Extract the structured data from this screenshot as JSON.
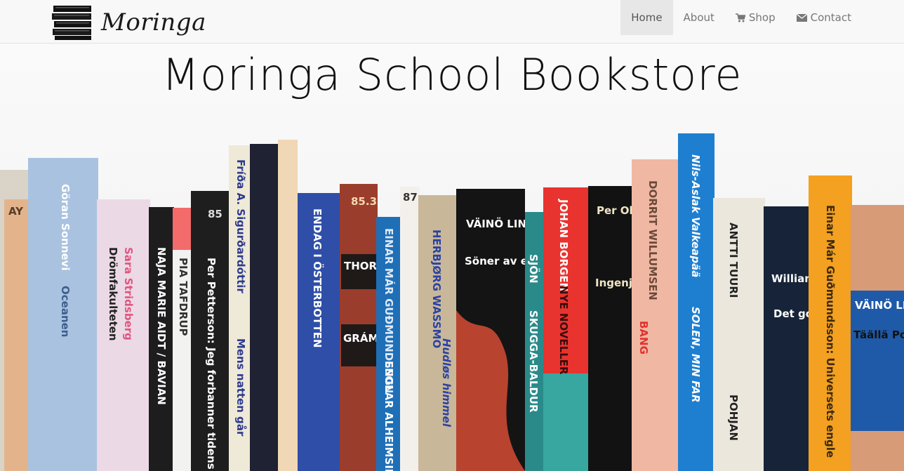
{
  "brand": {
    "name": "Moringa",
    "logo_icon": "stacked-books-icon"
  },
  "nav": {
    "items": [
      {
        "label": "Home",
        "icon": "",
        "active": true
      },
      {
        "label": "About",
        "icon": "",
        "active": false
      },
      {
        "label": "Shop",
        "icon": "cart-icon",
        "active": false
      },
      {
        "label": "Contact",
        "icon": "envelope-icon",
        "active": false
      }
    ]
  },
  "hero": {
    "title": "Moringa School Bookstore",
    "image": "bookshelf-photo",
    "spines": {
      "s1": "AY",
      "s2": "Göran Sonnevi",
      "s3": "Oceanen",
      "s4": "Sara Stridsberg",
      "s5": "Drömfakulteten",
      "s6": "NAJA MARIE AIDT / BAVIAN",
      "s7": "PIA TAFDRUP",
      "s8": "85",
      "s9": "Per Petterson: Jeg forbanner tidens elv",
      "s10": "Fríða A. Sigurðardóttir",
      "s11": "Mens natten går",
      "s12": "ENDAG I ÖSTERBOTTEN",
      "s13": "85.3",
      "s14": "THOR VILHJÁLMSSON",
      "s15": "GRÁMOSINN GLÓIR",
      "s16": "EINAR MÁR GUÐMUNDSSON",
      "s17": "ENGLAR ALHEIMSINS",
      "s18": "87",
      "s19": "HERBJØRG WASSMO",
      "s20": "Hudløs himmel",
      "s21": "VÄINÖ LINNA",
      "s22": "Söner av ett folk",
      "s23": "SJÖN",
      "s24": "SKUGGA-BALDUR",
      "s25": "JOHAN BORGEN",
      "s26": "NYE NOVELLER",
      "s27": "Per Olof Sundman",
      "s28": "Ingenjör Andrées luftfärd",
      "s29": "DORRIT WILLUMSEN",
      "s30": "BANG",
      "s31": "Nils-Aslak Valkeapää",
      "s32": "SOLEN, MIN FAR",
      "s33": "ANTTI TUURI",
      "s34": "POHJAN",
      "s35": "William Heinesen",
      "s36": "Det gode håb",
      "s37": "Einar Már Guðmundsson: Universets engle",
      "s38": "VÄINÖ LINNA",
      "s39": "Täällä Pohjantähden alla"
    }
  },
  "colors": {
    "navbar_bg": "#f8f8f8",
    "nav_active_bg": "#e7e7e7",
    "nav_text": "#777777",
    "title_text": "#111111"
  }
}
